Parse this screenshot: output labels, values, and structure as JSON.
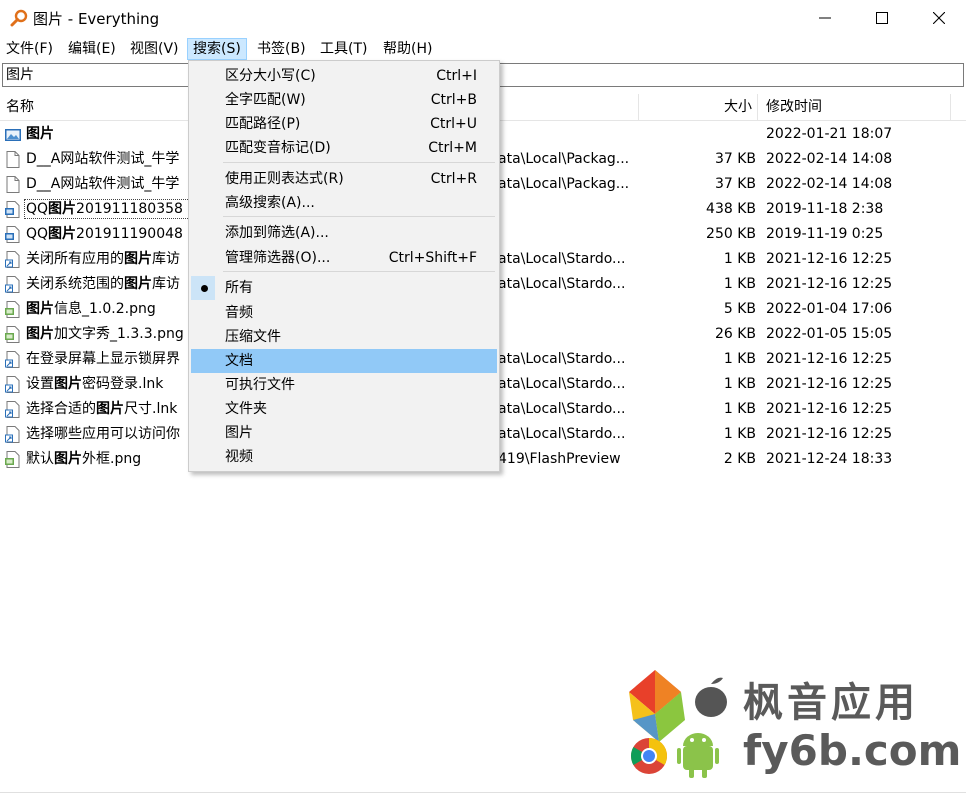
{
  "window": {
    "title": "图片 - Everything"
  },
  "menubar": {
    "file": "文件(F)",
    "edit": "编辑(E)",
    "view": "视图(V)",
    "search": "搜索(S)",
    "bookmarks": "书签(B)",
    "tools": "工具(T)",
    "help": "帮助(H)"
  },
  "search": {
    "value": "图片"
  },
  "columns": {
    "name": "名称",
    "size": "大小",
    "modified": "修改时间"
  },
  "rows": [
    {
      "prefix": "",
      "bold": "图片",
      "suffix": "",
      "path": "",
      "size": "",
      "date": "2022-01-21 18:07",
      "icon": "picture-folder-icon"
    },
    {
      "prefix": "D__A网站软件测试_牛学",
      "bold": "",
      "suffix": "",
      "path": "ata\\Local\\Packag...",
      "size": "37 KB",
      "date": "2022-02-14 14:08",
      "icon": "document-icon"
    },
    {
      "prefix": "D__A网站软件测试_牛学",
      "bold": "",
      "suffix": "",
      "path": "ata\\Local\\Packag...",
      "size": "37 KB",
      "date": "2022-02-14 14:08",
      "icon": "document-icon"
    },
    {
      "prefix": "QQ",
      "bold": "图片",
      "suffix": "201911180358",
      "path": "",
      "size": "438 KB",
      "date": "2019-11-18 2:38",
      "icon": "image-file-icon"
    },
    {
      "prefix": "QQ",
      "bold": "图片",
      "suffix": "201911190048",
      "path": "",
      "size": "250 KB",
      "date": "2019-11-19 0:25",
      "icon": "image-file-icon"
    },
    {
      "prefix": "关闭所有应用的",
      "bold": "图片",
      "suffix": "库访",
      "path": "ata\\Local\\Stardo...",
      "size": "1 KB",
      "date": "2021-12-16 12:25",
      "icon": "shortcut-icon"
    },
    {
      "prefix": "关闭系统范围的",
      "bold": "图片",
      "suffix": "库访",
      "path": "ata\\Local\\Stardo...",
      "size": "1 KB",
      "date": "2021-12-16 12:25",
      "icon": "shortcut-icon"
    },
    {
      "prefix": "",
      "bold": "图片",
      "suffix": "信息_1.0.2.png",
      "path": "",
      "size": "5 KB",
      "date": "2022-01-04 17:06",
      "icon": "png-file-icon"
    },
    {
      "prefix": "",
      "bold": "图片",
      "suffix": "加文字秀_1.3.3.png",
      "path": "",
      "size": "26 KB",
      "date": "2022-01-05 15:05",
      "icon": "png-file-icon"
    },
    {
      "prefix": "在登录屏幕上显示锁屏界",
      "bold": "",
      "suffix": "",
      "path": "ata\\Local\\Stardo...",
      "size": "1 KB",
      "date": "2021-12-16 12:25",
      "icon": "shortcut-icon"
    },
    {
      "prefix": "设置",
      "bold": "图片",
      "suffix": "密码登录.lnk",
      "path": "ata\\Local\\Stardo...",
      "size": "1 KB",
      "date": "2021-12-16 12:25",
      "icon": "shortcut-icon"
    },
    {
      "prefix": "选择合适的",
      "bold": "图片",
      "suffix": "尺寸.lnk",
      "path": "ata\\Local\\Stardo...",
      "size": "1 KB",
      "date": "2021-12-16 12:25",
      "icon": "shortcut-icon"
    },
    {
      "prefix": "选择哪些应用可以访问你",
      "bold": "",
      "suffix": "",
      "path": "ata\\Local\\Stardo...",
      "size": "1 KB",
      "date": "2021-12-16 12:25",
      "icon": "shortcut-icon"
    },
    {
      "prefix": "默认",
      "bold": "图片",
      "suffix": "外框.png",
      "path": "419\\FlashPreview",
      "size": "2 KB",
      "date": "2021-12-24 18:33",
      "icon": "png-file-icon"
    }
  ],
  "search_menu": {
    "items": [
      {
        "label": "区分大小写(C)",
        "shortcut": "Ctrl+I"
      },
      {
        "label": "全字匹配(W)",
        "shortcut": "Ctrl+B"
      },
      {
        "label": "匹配路径(P)",
        "shortcut": "Ctrl+U"
      },
      {
        "label": "匹配变音标记(D)",
        "shortcut": "Ctrl+M"
      },
      {
        "label": "使用正则表达式(R)",
        "shortcut": "Ctrl+R"
      },
      {
        "label": "高级搜索(A)...",
        "shortcut": ""
      },
      {
        "label": "添加到筛选(A)...",
        "shortcut": ""
      },
      {
        "label": "管理筛选器(O)...",
        "shortcut": "Ctrl+Shift+F"
      },
      {
        "label": "所有",
        "shortcut": ""
      },
      {
        "label": "音频",
        "shortcut": ""
      },
      {
        "label": "压缩文件",
        "shortcut": ""
      },
      {
        "label": "文档",
        "shortcut": ""
      },
      {
        "label": "可执行文件",
        "shortcut": ""
      },
      {
        "label": "文件夹",
        "shortcut": ""
      },
      {
        "label": "图片",
        "shortcut": ""
      },
      {
        "label": "视频",
        "shortcut": ""
      }
    ],
    "checked_index": 8,
    "highlighted_index": 11
  },
  "watermark": {
    "line1": "枫音应用",
    "line2": "fy6b.com"
  },
  "colors": {
    "menu_highlight": "#91c9f7",
    "menu_active": "#cce8ff",
    "accent_icon": "#e0701a"
  }
}
